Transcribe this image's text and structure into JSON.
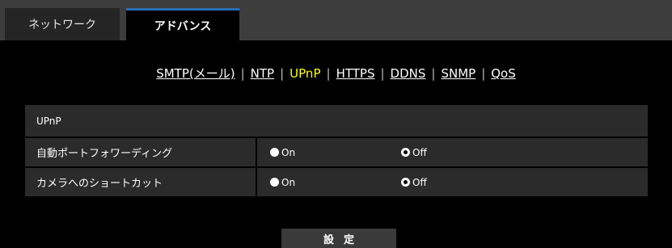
{
  "tabs": {
    "network": "ネットワーク",
    "advanced": "アドバンス"
  },
  "subnav": {
    "smtp": "SMTP(メール)",
    "ntp": "NTP",
    "upnp": "UPnP",
    "https": "HTTPS",
    "ddns": "DDNS",
    "snmp": "SNMP",
    "qos": "QoS",
    "separator": "|"
  },
  "panel": {
    "section_title": "UPnP",
    "rows": [
      {
        "label": "自動ポートフォワーディング",
        "on_label": "On",
        "off_label": "Off",
        "selected": "Off"
      },
      {
        "label": "カメラへのショートカット",
        "on_label": "On",
        "off_label": "Off",
        "selected": "Off"
      }
    ]
  },
  "submit_label": "設定"
}
